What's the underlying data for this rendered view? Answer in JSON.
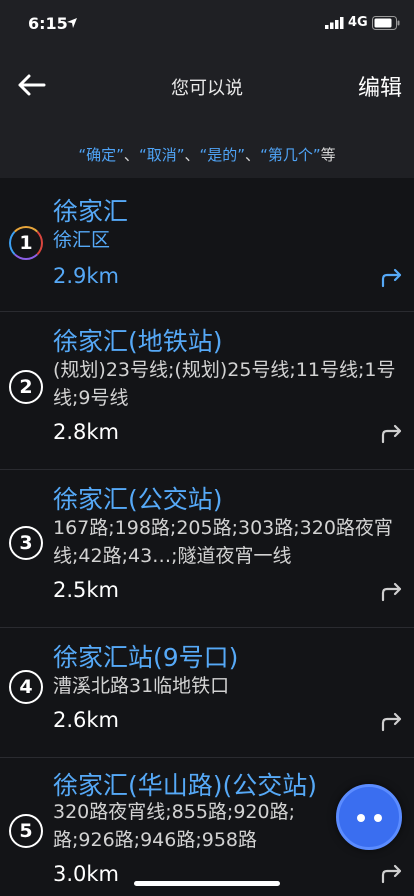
{
  "status": {
    "time": "6:15",
    "network": "4G"
  },
  "header": {
    "title": "您可以说",
    "edit_label": "编辑",
    "hint": {
      "q1": "“确定”",
      "sep1": "、",
      "q2": "“取消”",
      "sep2": "、",
      "q3": "“是的”",
      "sep3": "、",
      "q4": "“第几个”",
      "suffix": "等"
    }
  },
  "results": [
    {
      "index": "1",
      "title": "徐家汇",
      "subtitle": "徐汇区",
      "distance": "2.9km"
    },
    {
      "index": "2",
      "title": "徐家汇(地铁站)",
      "subtitle": "(规划)23号线;(规划)25号线;11号线;1号线;9号线",
      "distance": "2.8km"
    },
    {
      "index": "3",
      "title": "徐家汇(公交站)",
      "subtitle": "167路;198路;205路;303路;320路夜宵线;42路;43…;隧道夜宵一线",
      "distance": "2.5km"
    },
    {
      "index": "4",
      "title": "徐家汇站(9号口)",
      "subtitle": "漕溪北路31临地铁口",
      "distance": "2.6km"
    },
    {
      "index": "5",
      "title": "徐家汇(华山路)(公交站)",
      "subtitle": "320路夜宵线;855路;920路;路;926路;946路;958路",
      "distance": "3.0km"
    }
  ],
  "colors": {
    "accent": "#56a9f7",
    "background": "#131417",
    "header": "#1f2024",
    "fab": "#3a6ef0"
  },
  "icons": {
    "back": "arrow-left-icon",
    "navigate": "turn-right-arrow-icon",
    "assistant": "voice-assistant-icon"
  }
}
